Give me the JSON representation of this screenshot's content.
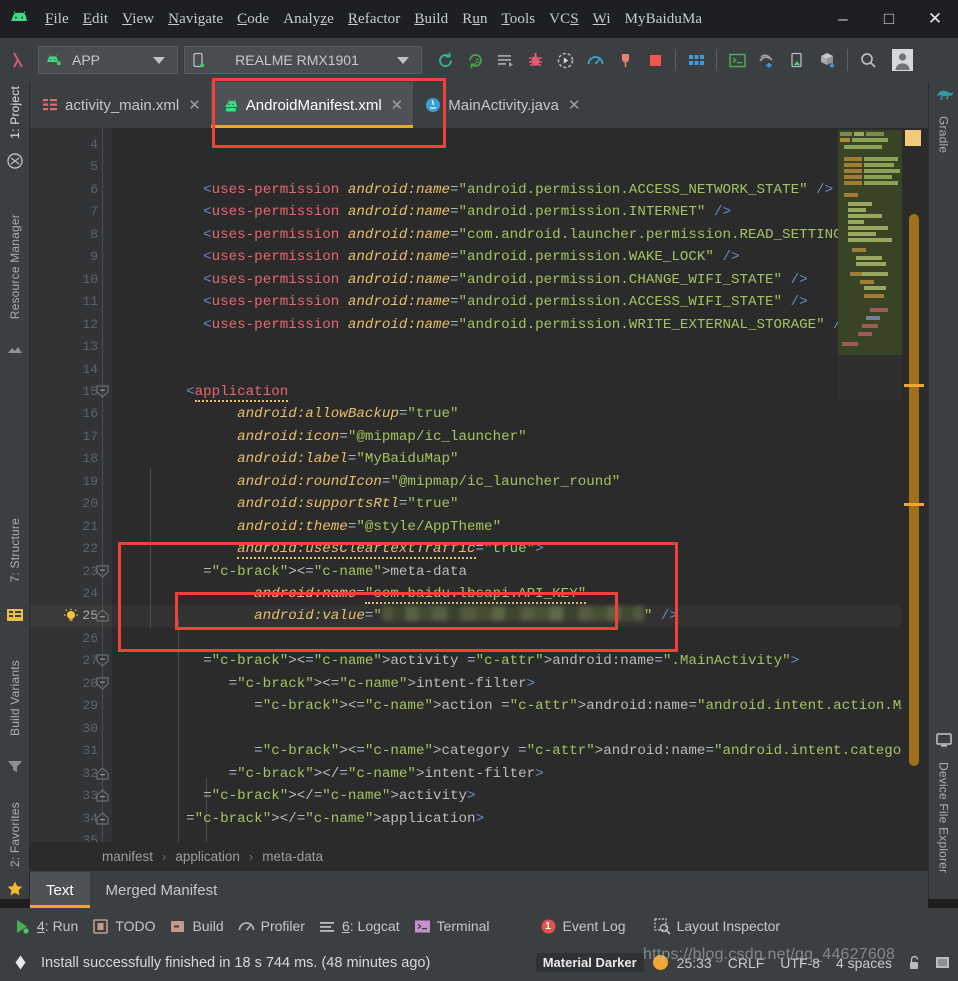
{
  "window": {
    "logo_icon": "android-studio-logo",
    "minimize_label": "–",
    "maximize_label": "□",
    "close_label": "✕"
  },
  "menubar": {
    "items": [
      {
        "label": "File",
        "mnemonic": "F"
      },
      {
        "label": "Edit",
        "mnemonic": "E"
      },
      {
        "label": "View",
        "mnemonic": "V"
      },
      {
        "label": "Navigate",
        "mnemonic": "N"
      },
      {
        "label": "Code",
        "mnemonic": "C"
      },
      {
        "label": "Analyze",
        "mnemonic": "z"
      },
      {
        "label": "Refactor",
        "mnemonic": "R"
      },
      {
        "label": "Build",
        "mnemonic": "B"
      },
      {
        "label": "Run",
        "mnemonic": "u"
      },
      {
        "label": "Tools",
        "mnemonic": "T"
      },
      {
        "label": "VCS",
        "mnemonic": "S"
      },
      {
        "label": "Wi",
        "mnemonic": "W"
      },
      {
        "label": "MyBaiduMa",
        "mnemonic": ""
      }
    ]
  },
  "toolbar": {
    "left_icon": "lambda-icon",
    "run_config": {
      "icon": "android-app-icon",
      "label": "APP",
      "caret_icon": "chevron-down-icon"
    },
    "device": {
      "icon": "phone-icon",
      "label": "REALME RMX1901",
      "caret_icon": "chevron-down-icon"
    },
    "icons": [
      "sync-project-gradle-icon",
      "avd-manager-icon",
      "run-icon",
      "debug-icon",
      "run-with-coverage-icon",
      "profiler-icon",
      "attach-debugger-icon",
      "stop-icon",
      "layout-editor-icon",
      "terminal-icon",
      "sdk-manager-icon",
      "device-file-explorer-icon",
      "build-apk-icon",
      "search-everywhere-icon",
      "user-avatar-icon"
    ]
  },
  "left_toolwindows": [
    {
      "label": "1: Project",
      "icon": "project-icon",
      "selected": true
    },
    {
      "label": "Resource Manager",
      "icon": "resource-manager-icon",
      "selected": false
    },
    {
      "label": "7: Structure",
      "icon": "structure-icon",
      "selected": false
    },
    {
      "label": "Build Variants",
      "icon": "build-variants-icon",
      "selected": false
    },
    {
      "label": "2: Favorites",
      "icon": "favorites-star-icon",
      "selected": false
    },
    {
      "label": "",
      "icon": "layers-icon",
      "selected": false
    }
  ],
  "right_toolwindows": [
    {
      "label": "Gradle",
      "icon": "gradle-elephant-icon"
    },
    {
      "label": "Device File Explorer",
      "icon": "device-monitor-icon"
    }
  ],
  "editor_tabs": [
    {
      "label": "activity_main.xml",
      "icon": "layout-xml-icon",
      "active": false,
      "close_icon": "✕"
    },
    {
      "label": "AndroidManifest.xml",
      "icon": "android-xml-icon",
      "active": true,
      "close_icon": "✕"
    },
    {
      "label": "MainActivity.java",
      "icon": "java-class-icon",
      "active": false,
      "close_icon": "✕"
    }
  ],
  "editor": {
    "first_line": 4,
    "current_line": 25,
    "gutter_lightbulb_icon": "intention-bulb-icon",
    "lines": [
      {
        "n": 4,
        "text": ""
      },
      {
        "n": 5,
        "text": ""
      },
      {
        "n": 6,
        "tag": "uses-permission",
        "attr": "android:name",
        "value": "android.permission.ACCESS_NETWORK_STATE"
      },
      {
        "n": 7,
        "tag": "uses-permission",
        "attr": "android:name",
        "value": "android.permission.INTERNET"
      },
      {
        "n": 8,
        "tag": "uses-permission",
        "attr": "android:name",
        "value": "com.android.launcher.permission.READ_SETTINGS"
      },
      {
        "n": 9,
        "tag": "uses-permission",
        "attr": "android:name",
        "value": "android.permission.WAKE_LOCK"
      },
      {
        "n": 10,
        "tag": "uses-permission",
        "attr": "android:name",
        "value": "android.permission.CHANGE_WIFI_STATE"
      },
      {
        "n": 11,
        "tag": "uses-permission",
        "attr": "android:name",
        "value": "android.permission.ACCESS_WIFI_STATE"
      },
      {
        "n": 12,
        "tag": "uses-permission",
        "attr": "android:name",
        "value": "android.permission.WRITE_EXTERNAL_STORAGE"
      },
      {
        "n": 13,
        "text": ""
      },
      {
        "n": 14,
        "text": ""
      },
      {
        "n": 15,
        "raw": "<application"
      },
      {
        "n": 16,
        "attr": "android:allowBackup",
        "value": "true"
      },
      {
        "n": 17,
        "attr": "android:icon",
        "value": "@mipmap/ic_launcher"
      },
      {
        "n": 18,
        "attr": "android:label",
        "value": "MyBaiduMap"
      },
      {
        "n": 19,
        "attr": "android:roundIcon",
        "value": "@mipmap/ic_launcher_round"
      },
      {
        "n": 20,
        "attr": "android:supportsRtl",
        "value": "true"
      },
      {
        "n": 21,
        "attr": "android:theme",
        "value": "@style/AppTheme"
      },
      {
        "n": 22,
        "attr": "android:usesCleartextTraffic",
        "value": "true",
        "suffix": ">"
      },
      {
        "n": 23,
        "raw": "<meta-data"
      },
      {
        "n": 24,
        "attr": "android:name",
        "value": "com.baidu.lbsapi.API_KEY"
      },
      {
        "n": 25,
        "attr": "android:value",
        "value": "[REDACTED]",
        "blurred": true,
        "suffix": "/>"
      },
      {
        "n": 26,
        "text": ""
      },
      {
        "n": 27,
        "raw": "<activity android:name=\".MainActivity\">"
      },
      {
        "n": 28,
        "raw": "<intent-filter>"
      },
      {
        "n": 29,
        "raw": "<action android:name=\"android.intent.action.MAIN\" />"
      },
      {
        "n": 30,
        "text": ""
      },
      {
        "n": 31,
        "raw": "<category android:name=\"android.intent.category.LAUNCHER\" />"
      },
      {
        "n": 32,
        "raw": "</intent-filter>"
      },
      {
        "n": 33,
        "raw": "</activity>"
      },
      {
        "n": 34,
        "raw": "</application>"
      },
      {
        "n": 35,
        "text": ""
      }
    ]
  },
  "annotations": {
    "boxes": [
      {
        "name": "manifest-tab-highlight"
      },
      {
        "name": "meta-data-block-highlight"
      },
      {
        "name": "api-key-value-highlight"
      }
    ],
    "color": "#f2403a"
  },
  "breadcrumb": {
    "items": [
      "manifest",
      "application",
      "meta-data"
    ],
    "separator": "›"
  },
  "sub_tabs": [
    {
      "label": "Text",
      "active": true
    },
    {
      "label": "Merged Manifest",
      "active": false
    }
  ],
  "bottom_toolwindows": [
    {
      "label": "4: Run",
      "mnemonic": "4",
      "icon": "run-green-icon",
      "badge": ""
    },
    {
      "label": "TODO",
      "mnemonic": "",
      "icon": "todo-icon",
      "badge": ""
    },
    {
      "label": "Build",
      "mnemonic": "",
      "icon": "build-icon",
      "badge": ""
    },
    {
      "label": "Profiler",
      "mnemonic": "",
      "icon": "profiler-gauge-icon",
      "badge": ""
    },
    {
      "label": "6: Logcat",
      "mnemonic": "6",
      "icon": "logcat-icon",
      "badge": ""
    },
    {
      "label": "Terminal",
      "mnemonic": "",
      "icon": "terminal-icon",
      "badge": ""
    },
    {
      "label": "Event Log",
      "mnemonic": "",
      "icon": "event-log-icon",
      "badge": "1"
    },
    {
      "label": "Layout Inspector",
      "mnemonic": "",
      "icon": "layout-inspector-icon",
      "badge": ""
    }
  ],
  "statusbar": {
    "status_icon": "gradle-status-icon",
    "message": "Install successfully finished in 18 s 744 ms. (48 minutes ago)",
    "theme_chip": "Material Darker",
    "theme_dot_color": "#f0a732",
    "caret_position": "25:33",
    "line_separator": "CRLF",
    "encoding": "UTF-8",
    "indent": "4 spaces",
    "lock_icon": "unlocked-icon",
    "memory_icon": "memory-indicator-icon"
  },
  "watermark": {
    "text": "https://blog.csdn.net/qq_44627608"
  }
}
